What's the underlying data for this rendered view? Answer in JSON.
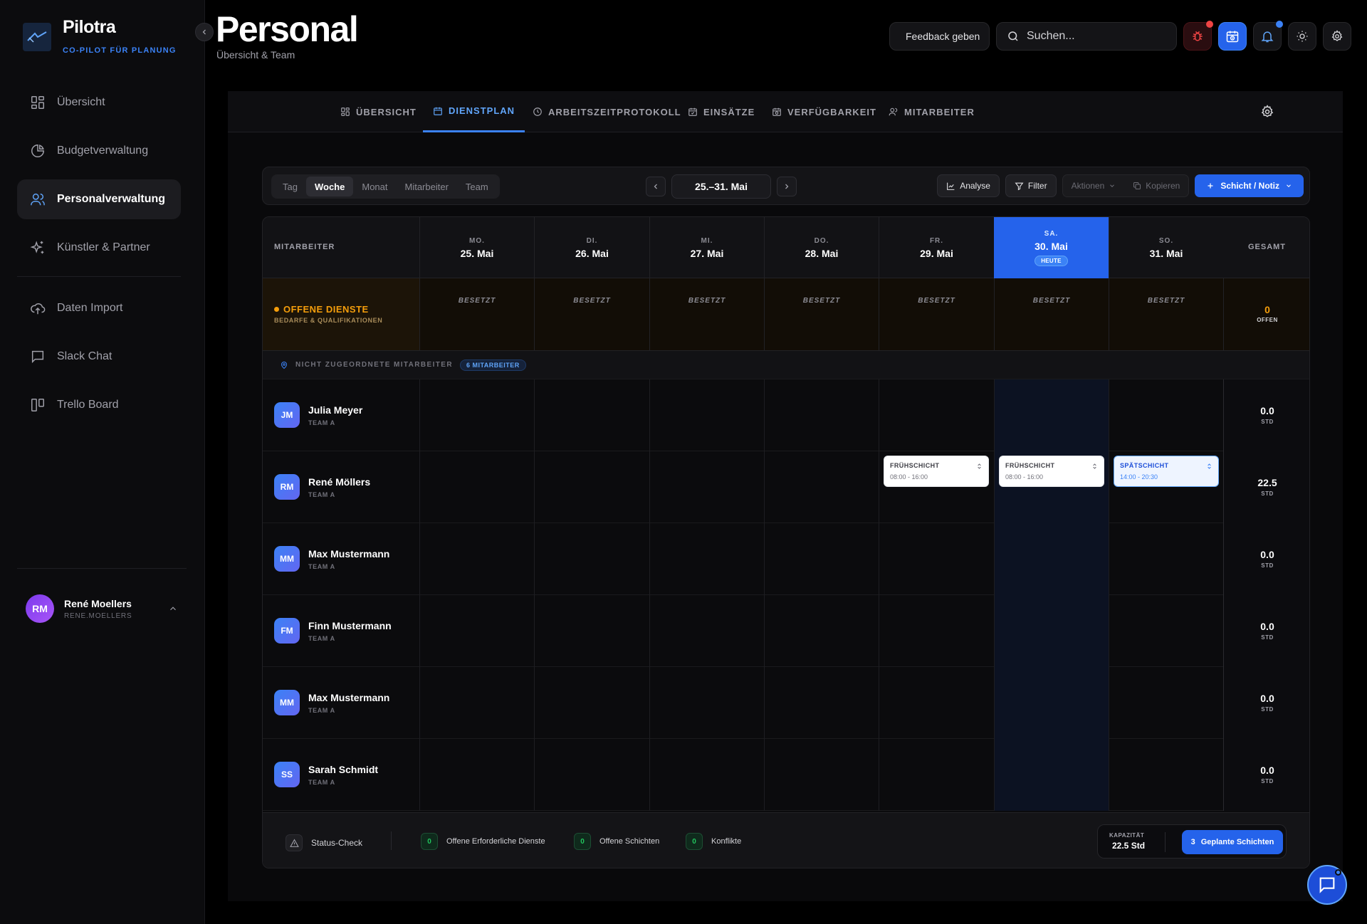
{
  "brand": {
    "name": "Pilotra",
    "tagline": "CO-PILOT FÜR PLANUNG"
  },
  "sidebar": {
    "items": [
      {
        "label": "Übersicht",
        "icon": "grid-icon",
        "active": false
      },
      {
        "label": "Budgetverwaltung",
        "icon": "pie-chart-icon",
        "active": false
      },
      {
        "label": "Personalverwaltung",
        "icon": "users-icon",
        "active": true
      },
      {
        "label": "Künstler & Partner",
        "icon": "sparkles-icon",
        "active": false
      },
      {
        "label": "Daten Import",
        "icon": "cloud-upload-icon",
        "active": false
      },
      {
        "label": "Slack Chat",
        "icon": "message-square-icon",
        "active": false
      },
      {
        "label": "Trello Board",
        "icon": "kanban-icon",
        "active": false
      }
    ],
    "user": {
      "initials": "RM",
      "name": "René Moellers",
      "handle": "RENE.MOELLERS"
    }
  },
  "header": {
    "title": "Personal",
    "subtitle": "Übersicht & Team",
    "feedback_label": "Feedback geben",
    "search_placeholder": "Suchen..."
  },
  "tabs": [
    {
      "label": "ÜBERSICHT",
      "icon": "grid-icon",
      "active": false
    },
    {
      "label": "DIENSTPLAN",
      "icon": "calendar-icon",
      "active": true
    },
    {
      "label": "ARBEITSZEITPROTOKOLL",
      "icon": "clock-icon",
      "active": false
    },
    {
      "label": "EINSÄTZE",
      "icon": "calendar-check-icon",
      "active": false
    },
    {
      "label": "VERFÜGBARKEIT",
      "icon": "calendar-clock-icon",
      "active": false
    },
    {
      "label": "MITARBEITER",
      "icon": "users-icon",
      "active": false
    }
  ],
  "toolbar": {
    "views": [
      {
        "label": "Tag",
        "active": false
      },
      {
        "label": "Woche",
        "active": true
      },
      {
        "label": "Monat",
        "active": false
      },
      {
        "label": "Mitarbeiter",
        "active": false
      },
      {
        "label": "Team",
        "active": false
      }
    ],
    "date_range": "25.–31. Mai",
    "analyse_label": "Analyse",
    "filter_label": "Filter",
    "actions_label": "Aktionen",
    "copy_label": "Kopieren",
    "add_label": "Schicht / Notiz"
  },
  "schedule": {
    "employee_header": "MITARBEITER",
    "total_header": "GESAMT",
    "days": [
      {
        "dow": "MO.",
        "date": "25. Mai",
        "today": false
      },
      {
        "dow": "DI.",
        "date": "26. Mai",
        "today": false
      },
      {
        "dow": "MI.",
        "date": "27. Mai",
        "today": false
      },
      {
        "dow": "DO.",
        "date": "28. Mai",
        "today": false
      },
      {
        "dow": "FR.",
        "date": "29. Mai",
        "today": false
      },
      {
        "dow": "SA.",
        "date": "30. Mai",
        "today": true
      },
      {
        "dow": "SO.",
        "date": "31. Mai",
        "today": false
      }
    ],
    "today_badge": "HEUTE",
    "open_services": {
      "title": "OFFENE DIENSTE",
      "subtitle": "BEDARFE & QUALIFIKATIONEN",
      "cell_status": "BESETZT",
      "total": "0",
      "total_label": "OFFEN"
    },
    "unassigned": {
      "label": "NICHT ZUGEORDNETE MITARBEITER",
      "badge": "6 MITARBEITER"
    },
    "hours_label": "STD",
    "employees": [
      {
        "initials": "JM",
        "name": "Julia Meyer",
        "team": "TEAM A",
        "total": "0.0",
        "shifts": []
      },
      {
        "initials": "RM",
        "name": "René Möllers",
        "team": "TEAM A",
        "total": "22.5",
        "shifts": [
          {
            "day": 4,
            "name": "FRÜHSCHICHT",
            "time": "08:00 - 16:00",
            "type": "early"
          },
          {
            "day": 5,
            "name": "FRÜHSCHICHT",
            "time": "08:00 - 16:00",
            "type": "early"
          },
          {
            "day": 6,
            "name": "SPÄTSCHICHT",
            "time": "14:00 - 20:30",
            "type": "late"
          }
        ]
      },
      {
        "initials": "MM",
        "name": "Max Mustermann",
        "team": "TEAM A",
        "total": "0.0",
        "shifts": []
      },
      {
        "initials": "FM",
        "name": "Finn Mustermann",
        "team": "TEAM A",
        "total": "0.0",
        "shifts": []
      },
      {
        "initials": "MM",
        "name": "Max Mustermann",
        "team": "TEAM A",
        "total": "0.0",
        "shifts": []
      },
      {
        "initials": "SS",
        "name": "Sarah Schmidt",
        "team": "TEAM A",
        "total": "0.0",
        "shifts": []
      }
    ]
  },
  "footer": {
    "status_label": "Status-Check",
    "stats": [
      {
        "value": "0",
        "label": "Offene Erforderliche Dienste"
      },
      {
        "value": "0",
        "label": "Offene Schichten"
      },
      {
        "value": "0",
        "label": "Konflikte"
      }
    ],
    "capacity_label": "KAPAZITÄT",
    "capacity_value": "22.5 Std",
    "planned_count": "3",
    "planned_label": "Geplante Schichten"
  },
  "colors": {
    "accent": "#2563eb",
    "warning": "#f59e0b",
    "success": "#22c55e",
    "danger": "#ef4444"
  }
}
